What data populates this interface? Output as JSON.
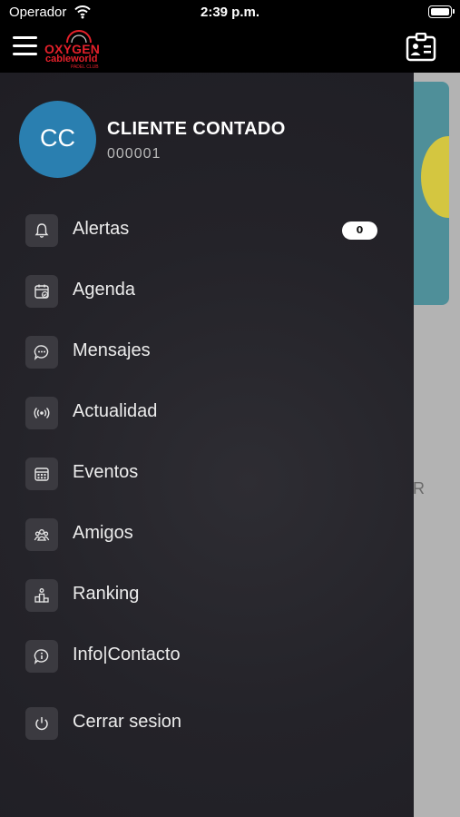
{
  "status_bar": {
    "carrier": "Operador",
    "time": "2:39 p.m.",
    "battery_level": 1.0
  },
  "header": {
    "logo_main": "OXYGEN",
    "logo_sub": "cableworld",
    "logo_tag": "PADEL CLUB"
  },
  "user": {
    "initials": "CC",
    "name": "CLIENTE CONTADO",
    "id": "000001"
  },
  "menu": {
    "items": [
      {
        "label": "Alertas",
        "icon": "bell-icon",
        "badge": "0"
      },
      {
        "label": "Agenda",
        "icon": "calendar-check-icon"
      },
      {
        "label": "Mensajes",
        "icon": "chat-bubble-icon"
      },
      {
        "label": "Actualidad",
        "icon": "broadcast-icon"
      },
      {
        "label": "Eventos",
        "icon": "calendar-grid-icon"
      },
      {
        "label": "Amigos",
        "icon": "group-icon"
      },
      {
        "label": "Ranking",
        "icon": "podium-icon"
      },
      {
        "label": "Info|Contacto",
        "icon": "info-bubble-icon"
      },
      {
        "label": "Cerrar sesion",
        "icon": "power-icon"
      }
    ]
  },
  "background": {
    "partial_letter": "R"
  },
  "colors": {
    "accent_brand": "#e3202a",
    "avatar_bg": "#2a7fb0",
    "drawer_bg": "#242329",
    "icon_tile": "#3b3a40"
  }
}
